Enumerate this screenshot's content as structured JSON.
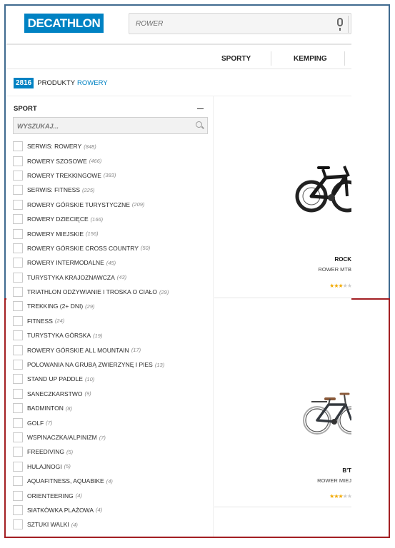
{
  "header": {
    "logo_text": "DECATHLON",
    "search_value": "ROWER",
    "nav": [
      "SPORTY",
      "KEMPING"
    ]
  },
  "results": {
    "count": "2816",
    "label": "PRODUKTY",
    "category": "ROWERY"
  },
  "facet": {
    "title": "SPORT",
    "search_placeholder": "WYSZUKAJ...",
    "items": [
      {
        "label": "SERWIS: ROWERY",
        "count": "(848)"
      },
      {
        "label": "ROWERY SZOSOWE",
        "count": "(466)"
      },
      {
        "label": "ROWERY TREKKINGOWE",
        "count": "(383)"
      },
      {
        "label": "SERWIS: FITNESS",
        "count": "(225)"
      },
      {
        "label": "ROWERY GÓRSKIE TURYSTYCZNE",
        "count": "(209)"
      },
      {
        "label": "ROWERY DZIECIĘCE",
        "count": "(166)"
      },
      {
        "label": "ROWERY MIEJSKIE",
        "count": "(156)"
      },
      {
        "label": "ROWERY GÓRSKIE CROSS COUNTRY",
        "count": "(50)"
      },
      {
        "label": "ROWERY INTERMODALNE",
        "count": "(45)"
      },
      {
        "label": "TURYSTYKA KRAJOZNAWCZA",
        "count": "(43)"
      },
      {
        "label": "TRIATHLON ODŻYWIANIE I TROSKA O CIAŁO",
        "count": "(29)"
      },
      {
        "label": "TREKKING (2+ DNI)",
        "count": "(29)"
      },
      {
        "label": "FITNESS",
        "count": "(24)"
      },
      {
        "label": "TURYSTYKA GÓRSKA",
        "count": "(19)"
      },
      {
        "label": "ROWERY GÓRSKIE ALL MOUNTAIN",
        "count": "(17)"
      },
      {
        "label": "POLOWANIA NA GRUBĄ ZWIERZYNĘ I PIES",
        "count": "(13)"
      },
      {
        "label": "STAND UP PADDLE",
        "count": "(10)"
      },
      {
        "label": "SANECZKARSTWO",
        "count": "(9)"
      },
      {
        "label": "BADMINTON",
        "count": "(8)"
      },
      {
        "label": "GOLF",
        "count": "(7)"
      },
      {
        "label": "WSPINACZKA/ALPINIZM",
        "count": "(7)"
      },
      {
        "label": "FREEDIVING",
        "count": "(5)"
      },
      {
        "label": "HULAJNOGI",
        "count": "(5)"
      },
      {
        "label": "AQUAFITNESS, AQUABIKE",
        "count": "(4)"
      },
      {
        "label": "ORIENTEERING",
        "count": "(4)"
      },
      {
        "label": "SIATKÓWKA PLAŻOWA",
        "count": "(4)"
      },
      {
        "label": "SZTUKI WALKI",
        "count": "(4)"
      }
    ]
  },
  "products": [
    {
      "name": "ROCK",
      "subtitle": "ROWER MTB",
      "rating": 3
    },
    {
      "name": "B'T",
      "subtitle": "ROWER MIEJ",
      "rating": 3
    }
  ],
  "colors": {
    "brand": "#0082c3",
    "frame_top": "#3f6a8f",
    "frame_bottom": "#a31f23",
    "stars": "#f2a900"
  }
}
